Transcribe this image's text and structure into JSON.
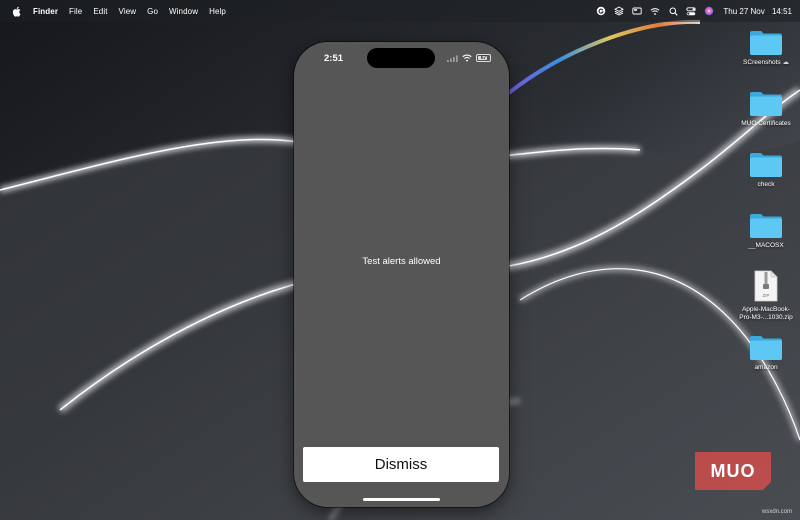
{
  "menubar": {
    "app_name": "Finder",
    "menus": [
      "File",
      "Edit",
      "View",
      "Go",
      "Window",
      "Help"
    ],
    "date": "Thu 27 Nov",
    "time": "14:51",
    "status_icons": [
      "grammarly-icon",
      "stack-icon",
      "display-icon",
      "wifi-icon",
      "search-icon",
      "control-center-icon",
      "siri-icon"
    ]
  },
  "desktop_icons": [
    {
      "label": "SCreenshots",
      "type": "folder",
      "icon": "folder-icon",
      "synced": true
    },
    {
      "label": "MUO Certificates",
      "type": "folder",
      "icon": "folder-icon"
    },
    {
      "label": "check",
      "type": "folder",
      "icon": "folder-icon"
    },
    {
      "label": "__MACOSX",
      "type": "folder",
      "icon": "folder-icon"
    },
    {
      "label": "Apple-MacBook-Pro-M3-...1030.zip",
      "label_line1": "Apple-MacBook-",
      "label_line2": "Pro-M3-...1030.zip",
      "type": "zip",
      "icon": "zip-file-icon",
      "badge": "ZIP"
    },
    {
      "label": "amazon",
      "type": "folder",
      "icon": "folder-icon"
    }
  ],
  "phone": {
    "status_time": "2:51",
    "battery": "67",
    "alert_text": "Test alerts allowed",
    "dismiss_label": "Dismiss"
  },
  "watermark": {
    "logo_text": "MUO",
    "credit": "wsxdn.com"
  },
  "colors": {
    "folder": "#5ec8f5",
    "phone_screen": "#565656",
    "watermark": "#c24d4c"
  }
}
